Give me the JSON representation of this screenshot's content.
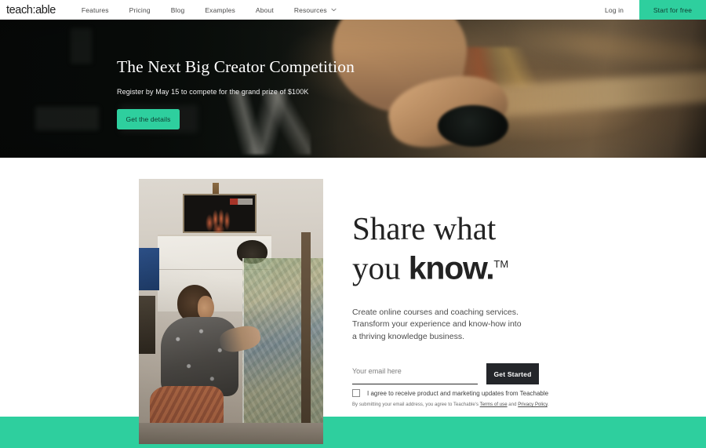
{
  "nav": {
    "logo": "teach:able",
    "links": [
      {
        "label": "Features"
      },
      {
        "label": "Pricing"
      },
      {
        "label": "Blog"
      },
      {
        "label": "Examples"
      },
      {
        "label": "About"
      },
      {
        "label": "Resources"
      }
    ],
    "login_label": "Log in",
    "cta_label": "Start for free",
    "cta_color": "#2ECF9E"
  },
  "hero": {
    "title": "The Next Big Creator Competition",
    "subtitle": "Register by May 15 to compete for the grand prize of $100K",
    "button_label": "Get the details",
    "button_color": "#2ECF9E"
  },
  "main": {
    "headline_line1": "Share what",
    "headline_line2_serif": "you ",
    "headline_line2_bold": "know.",
    "headline_trademark": "TM",
    "lede": "Create online courses and coaching services. Transform your experience and know-how into a thriving knowledge business.",
    "form": {
      "email_placeholder": "Your email here",
      "email_value": "",
      "submit_label": "Get Started",
      "submit_color": "#24262a",
      "consent_label": "I agree to receive product and marketing updates from Teachable",
      "consent_checked": false,
      "legal_prefix": "By submitting your email address, you agree to Teachable's ",
      "legal_terms": "Terms of use",
      "legal_mid": " and ",
      "legal_privacy": "Privacy Policy",
      "legal_suffix": "."
    }
  },
  "footer": {
    "band_color": "#2ECF9E"
  }
}
